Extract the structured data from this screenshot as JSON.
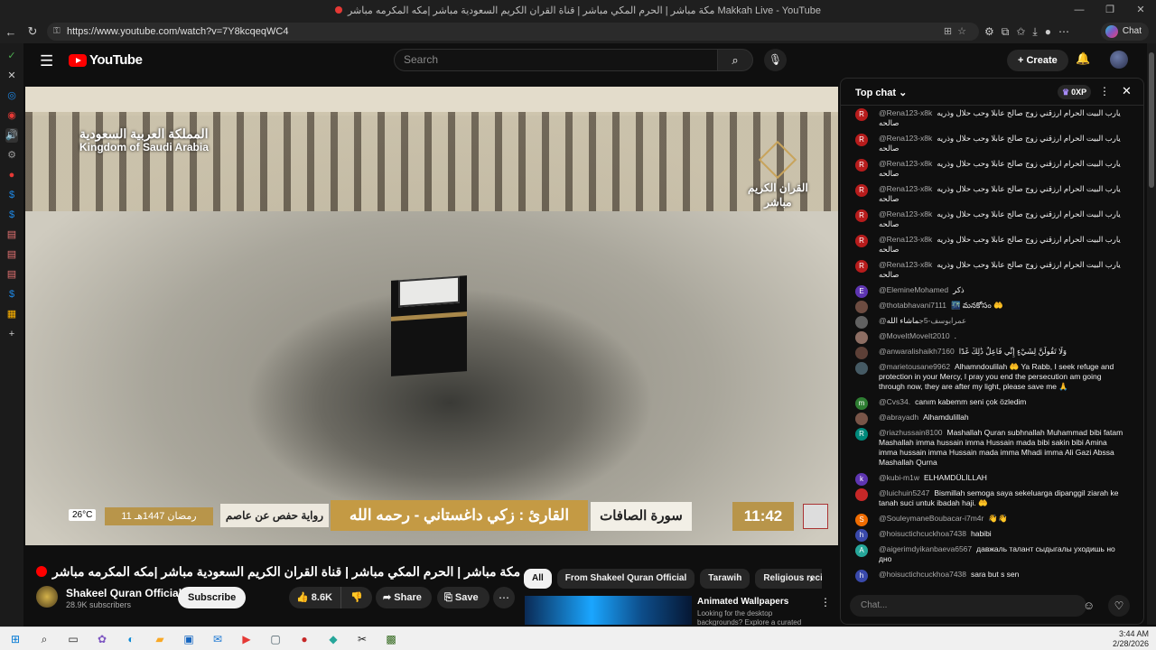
{
  "browser": {
    "window_title": "مكة مباشر | الحرم المكي مباشر | قناة القران الكريم السعودية مباشر |مكه المكرمه مباشر Makkah Live - YouTube",
    "url": "https://www.youtube.com/watch?v=7Y8kcqeqWC4",
    "copilot_label": "Chat",
    "window_controls": [
      "—",
      "❐",
      "✕"
    ]
  },
  "youtube": {
    "logo_text": "YouTube",
    "search_placeholder": "Search",
    "create_label": "Create"
  },
  "video_overlay": {
    "country_ar": "المملكة العربية السعودية",
    "country_en": "Kingdom of Saudi Arabia",
    "logo_ar_line1": "القران الكريم",
    "logo_ar_line2": "مباشر",
    "temperature": "26°C",
    "hijri_date": "11 رمضان 1447هـ",
    "riwaya": "رواية حفص عن عاصم",
    "qari": "القارئ : زكي داغستاني - رحمه الله",
    "surah": "سورة الصافات",
    "clock": "11:42"
  },
  "video": {
    "title": "مكة مباشر | الحرم المكي مباشر | قناة القران الكريم السعودية مباشر |مكه المكرمه مباشر | Makkah Live",
    "channel_name": "Shakeel Quran Official",
    "subscribers": "28.9K subscribers",
    "subscribe_label": "Subscribe",
    "likes": "8.6K",
    "share_label": "Share",
    "save_label": "Save"
  },
  "chips": [
    {
      "label": "All",
      "active": true
    },
    {
      "label": "From Shakeel Quran Official",
      "active": false
    },
    {
      "label": "Tarawih",
      "active": false
    },
    {
      "label": "Religious recitat",
      "active": false
    }
  ],
  "recommendation": {
    "title": "Animated Wallpapers",
    "subtitle": "Looking for the desktop backgrounds? Explore a curated"
  },
  "chat": {
    "title": "Top chat",
    "xp": "0XP",
    "input_placeholder": "Chat...",
    "messages": [
      {
        "user": "@Rena123-x8k",
        "text": "يارب البيت الحرام ارزقني زوج صالح عابلا وحب حلال وذريه صالحه",
        "initial": "R",
        "color": "#b71c1c"
      },
      {
        "user": "@Rena123-x8k",
        "text": "يارب البيت الحرام ارزقني زوج صالح عابلا وحب حلال وذريه صالحه",
        "initial": "R",
        "color": "#b71c1c"
      },
      {
        "user": "@Rena123-x8k",
        "text": "يارب البيت الحرام ارزقني زوج صالح عابلا وحب حلال وذريه صالحه",
        "initial": "R",
        "color": "#b71c1c"
      },
      {
        "user": "@Rena123-x8k",
        "text": "يارب البيت الحرام ارزقني زوج صالح عابلا وحب حلال وذريه صالحه",
        "initial": "R",
        "color": "#b71c1c"
      },
      {
        "user": "@Rena123-x8k",
        "text": "يارب البيت الحرام ارزقني زوج صالح عابلا وحب حلال وذريه صالحه",
        "initial": "R",
        "color": "#b71c1c"
      },
      {
        "user": "@Rena123-x8k",
        "text": "يارب البيت الحرام ارزقني زوج صالح عابلا وحب حلال وذريه صالحه",
        "initial": "R",
        "color": "#b71c1c"
      },
      {
        "user": "@Rena123-x8k",
        "text": "يارب البيت الحرام ارزقني زوج صالح عابلا وحب حلال وذريه صالحه",
        "initial": "R",
        "color": "#b71c1c"
      },
      {
        "user": "@ElemineMohamed",
        "text": "ذكر",
        "initial": "E",
        "color": "#5e35b1"
      },
      {
        "user": "@thotabhavani7111",
        "text": "🌃 మనకోసం 🤲",
        "initial": "",
        "color": "#6d4c41"
      },
      {
        "user": "@عمرابوسف-5ج",
        "text": "ماشاء الله",
        "initial": "",
        "color": "#616161"
      },
      {
        "user": "@MoveItMoveIt2010",
        "text": ".",
        "initial": "",
        "color": "#8d6e63"
      },
      {
        "user": "@anwaralishaikh7160",
        "text": "وَلَا تَقُولَنَّ لِشَيْءٍ إِنِّي فَاعِلٌ ذَٰلِكَ غَدًا",
        "initial": "",
        "color": "#5d4037"
      },
      {
        "user": "@marietousane9962",
        "text": "Alhamndoulilah 🤲 Ya Rabb, I seek refuge and protection in your Mercy, I pray you end the persecution am going through now, they are after my light, please save me 🙏",
        "initial": "",
        "color": "#455a64"
      },
      {
        "user": "@Cvs34.",
        "text": "canım kabemm seni çok özledim",
        "initial": "m",
        "color": "#2e7d32"
      },
      {
        "user": "@abrayadh",
        "text": "Alhamdulillah",
        "initial": "",
        "color": "#795548"
      },
      {
        "user": "@riazhussain8100",
        "text": "Mashallah Quran subhnallah Muhammad bibi fatam Mashallah imma hussain imma Hussain mada bibi sakin bibi Amina imma hussain imma Hussain mada imma Mhadi imma Ali Gazi Abssa Mashallah Qurna",
        "initial": "R",
        "color": "#00897b"
      },
      {
        "user": "@kubi-m1w",
        "text": "ELHAMDÜLİLLAH",
        "initial": "k",
        "color": "#5e35b1"
      },
      {
        "user": "@luichuin5247",
        "text": "Bismillah semoga saya sekeluarga dipanggil ziarah ke tanah suci untuk ibadah haji. 🤲",
        "initial": "",
        "color": "#c62828"
      },
      {
        "user": "@SouleymaneBoubacar-i7m4r",
        "text": "👋👋",
        "initial": "S",
        "color": "#ef6c00"
      },
      {
        "user": "@hoisuctichcuckhoa7438",
        "text": "habibi",
        "initial": "h",
        "color": "#3949ab"
      },
      {
        "user": "@aigerimdyikanbaeva6567",
        "text": "давжаль талант сыдыгалы уходишь но дно",
        "initial": "A",
        "color": "#26a69a"
      },
      {
        "user": "@hoisuctichcuckhoa7438",
        "text": "sara but s sen",
        "initial": "h",
        "color": "#3949ab"
      }
    ]
  },
  "taskbar": {
    "time": "3:44 AM",
    "date": "2/28/2026"
  }
}
